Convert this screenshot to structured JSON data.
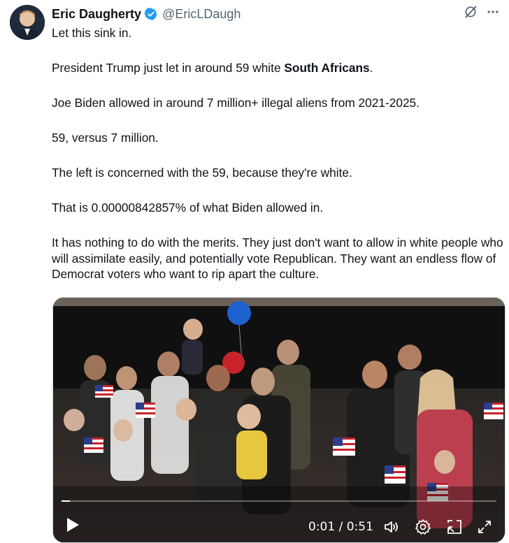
{
  "author": {
    "name": "Eric Daugherty",
    "handle": "@EricLDaugh",
    "verified": true
  },
  "icons": {
    "verified": "verified-badge-icon",
    "grok": "grok-icon",
    "more": "more-icon"
  },
  "tweet": {
    "p1": "Let this sink in.",
    "p2_before": "President Trump just let in around 59 white ",
    "p2_bold": "South Africans",
    "p2_after": ".",
    "p3": "Joe Biden allowed in around 7 million+ illegal aliens from 2021-2025.",
    "p4": "59, versus 7 million.",
    "p5": "The left is concerned with the 59, because they're white.",
    "p6": "That is 0.00000842857% of what Biden allowed in.",
    "p7": "It has nothing to do with the merits. They just don't want to allow in white people who will assimilate easily, and potentially vote Republican. They want an endless flow of Democrat voters who want to rip apart the culture."
  },
  "video": {
    "time": "0:01 / 0:51",
    "progress": 0.02,
    "controls": [
      "play-icon",
      "volume-icon",
      "settings-icon",
      "pip-icon",
      "fullscreen-icon"
    ]
  },
  "colors": {
    "verified": "#1d9bf0",
    "text": "#0f1419",
    "secondary": "#536471"
  }
}
